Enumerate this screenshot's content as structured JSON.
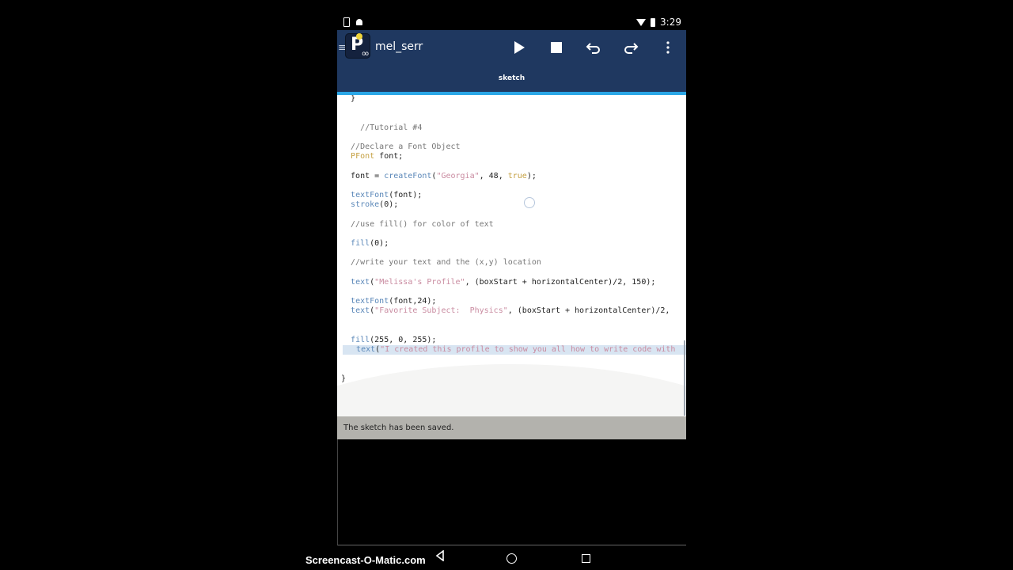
{
  "status_bar": {
    "time": "3:29"
  },
  "app_bar": {
    "sketch_name": "mel_serr",
    "tab": "sketch",
    "toolbar": {
      "run": "▶",
      "stop": "■",
      "undo": "↶",
      "redo": "↷",
      "more": "⋮"
    }
  },
  "editor": {
    "lines": [
      "  }",
      "",
      "",
      "    //Tutorial #4",
      "",
      "  //Declare a Font Object",
      "  PFont font;",
      "",
      "  font = createFont(\"Georgia\", 48, true);",
      "",
      "  textFont(font);",
      "  stroke(0);",
      "",
      "  //use fill() for color of text",
      "",
      "  fill(0);",
      "",
      "  //write your text and the (x,y) location",
      "",
      "  text(\"Melissa's Profile\", (boxStart + horizontalCenter)/2, 150);",
      "",
      "  textFont(font,24);",
      "  text(\"Favorite Subject:  Physics\", (boxStart + horizontalCenter)/2,",
      "",
      "",
      "  fill(255, 0, 255);",
      "  text(\"I created this profile to show you all how to write code with",
      "",
      "",
      "}"
    ]
  },
  "message": "The sketch has been saved.",
  "nav_bar": {
    "back": "◁",
    "home": "○",
    "recents": "□"
  },
  "watermark": "Screencast-O-Matic.com"
}
